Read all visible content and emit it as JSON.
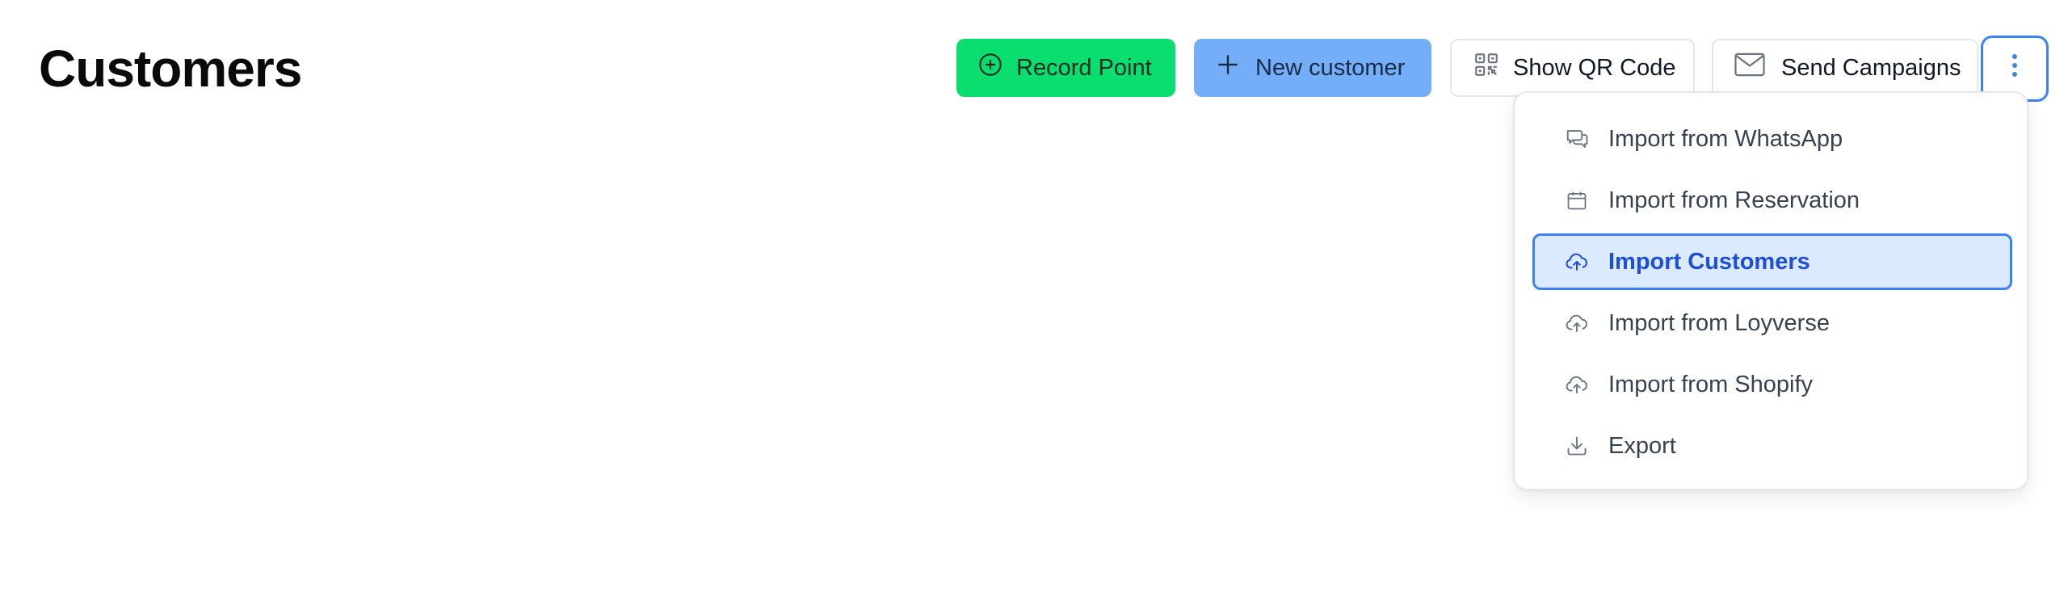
{
  "header": {
    "title": "Customers"
  },
  "toolbar": {
    "record_point": "Record Point",
    "new_customer": "New customer",
    "show_qr": "Show QR Code",
    "send_campaigns": "Send Campaigns"
  },
  "menu": {
    "items": [
      {
        "label": "Import from WhatsApp",
        "icon": "chat-bubbles-icon"
      },
      {
        "label": "Import from Reservation",
        "icon": "calendar-icon"
      },
      {
        "label": "Import Customers",
        "icon": "cloud-upload-icon",
        "active": true
      },
      {
        "label": "Import from Loyverse",
        "icon": "cloud-upload-icon"
      },
      {
        "label": "Import from Shopify",
        "icon": "cloud-upload-icon"
      },
      {
        "label": "Export",
        "icon": "download-icon"
      }
    ]
  },
  "colors": {
    "record_bg": "#0ade6f",
    "new_bg": "#74aef9",
    "accent": "#3b82f6",
    "active_bg": "#dbeafe",
    "active_text": "#1d4ed8"
  }
}
